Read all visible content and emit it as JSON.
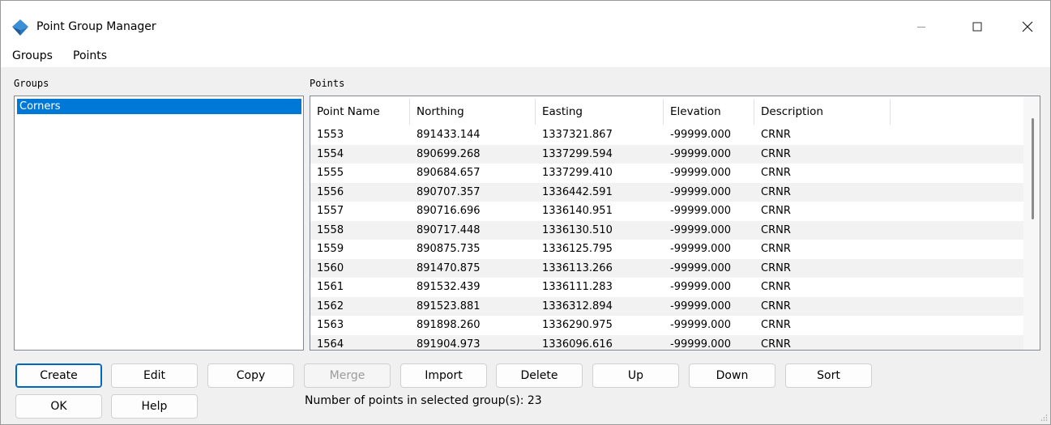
{
  "window": {
    "title": "Point Group Manager",
    "icons": {
      "app": "app-logo-icon",
      "minimize": "minimize-icon",
      "maximize": "maximize-icon",
      "close": "close-icon"
    }
  },
  "menu": {
    "items": [
      "Groups",
      "Points"
    ]
  },
  "groups": {
    "label": "Groups",
    "items": [
      "Corners"
    ],
    "selected": "Corners"
  },
  "points": {
    "label": "Points",
    "columns": [
      "Point Name",
      "Northing",
      "Easting",
      "Elevation",
      "Description"
    ],
    "rows": [
      [
        "1553",
        "891433.144",
        "1337321.867",
        "-99999.000",
        "CRNR"
      ],
      [
        "1554",
        "890699.268",
        "1337299.594",
        "-99999.000",
        "CRNR"
      ],
      [
        "1555",
        "890684.657",
        "1337299.410",
        "-99999.000",
        "CRNR"
      ],
      [
        "1556",
        "890707.357",
        "1336442.591",
        "-99999.000",
        "CRNR"
      ],
      [
        "1557",
        "890716.696",
        "1336140.951",
        "-99999.000",
        "CRNR"
      ],
      [
        "1558",
        "890717.448",
        "1336130.510",
        "-99999.000",
        "CRNR"
      ],
      [
        "1559",
        "890875.735",
        "1336125.795",
        "-99999.000",
        "CRNR"
      ],
      [
        "1560",
        "891470.875",
        "1336113.266",
        "-99999.000",
        "CRNR"
      ],
      [
        "1561",
        "891532.439",
        "1336111.283",
        "-99999.000",
        "CRNR"
      ],
      [
        "1562",
        "891523.881",
        "1336312.894",
        "-99999.000",
        "CRNR"
      ],
      [
        "1563",
        "891898.260",
        "1336290.975",
        "-99999.000",
        "CRNR"
      ],
      [
        "1564",
        "891904.973",
        "1336096.616",
        "-99999.000",
        "CRNR"
      ]
    ]
  },
  "buttons": {
    "create": "Create",
    "edit": "Edit",
    "copy": "Copy",
    "merge": "Merge",
    "import": "Import",
    "delete": "Delete",
    "up": "Up",
    "down": "Down",
    "sort": "Sort",
    "ok": "OK",
    "help": "Help"
  },
  "status": "Number of points in selected group(s):  23",
  "colors": {
    "selection": "#0078d7",
    "default_button_border": "#0067c0",
    "app_icon": "#1f6fb5"
  }
}
